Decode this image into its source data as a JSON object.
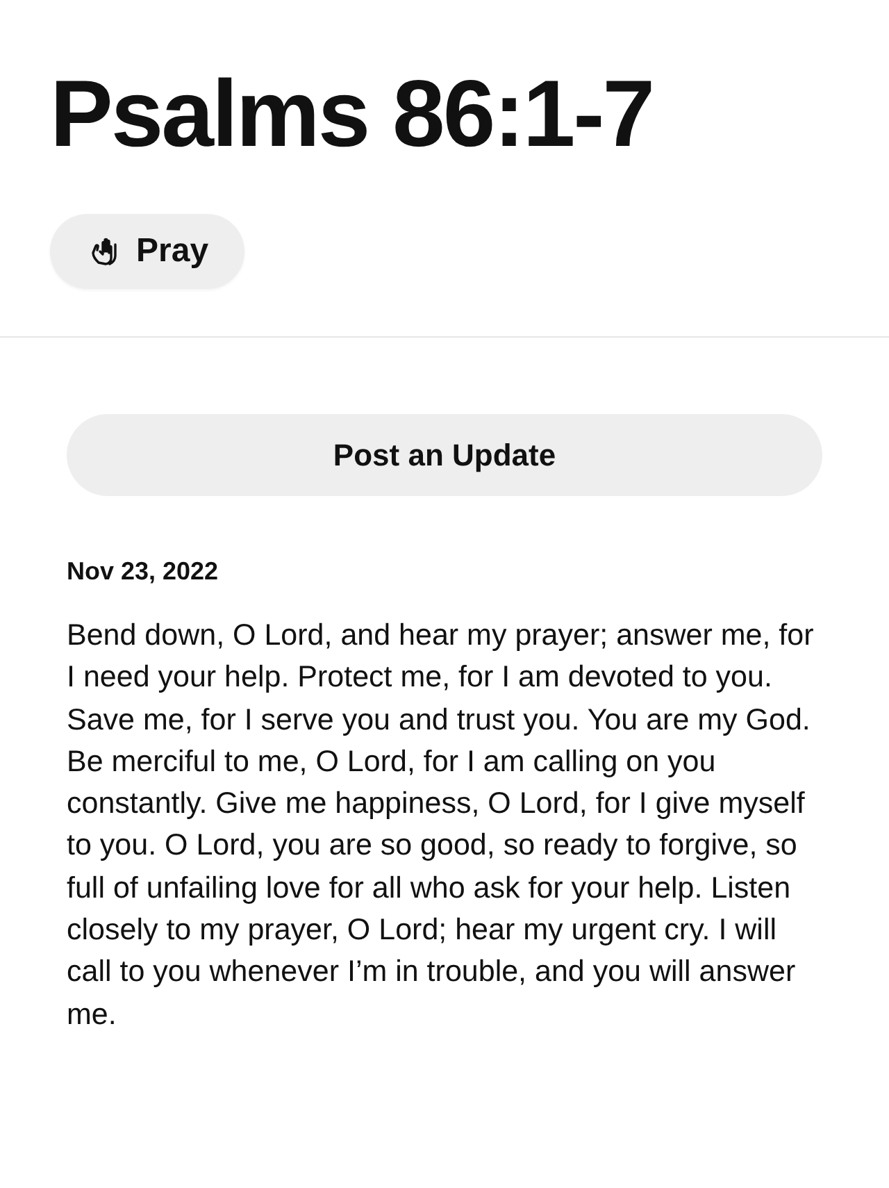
{
  "title": "Psalms 86:1-7",
  "pray_button": {
    "label": "Pray"
  },
  "update_button": {
    "label": "Post an Update"
  },
  "post": {
    "date": "Nov 23, 2022",
    "text": "Bend down, O Lord, and hear my prayer; answer me, for I need your help. Protect me, for I am devoted to you. Save me, for I serve you and trust you. You are my God. Be merciful to me, O Lord, for I am calling on you constantly. Give me happiness, O Lord, for I give myself to you. O Lord, you are so good, so ready to forgive, so full of unfailing love for all who ask for your help. Listen closely to my prayer, O Lord; hear my urgent cry. I will call to you whenever I’m in trouble, and you will answer me."
  }
}
